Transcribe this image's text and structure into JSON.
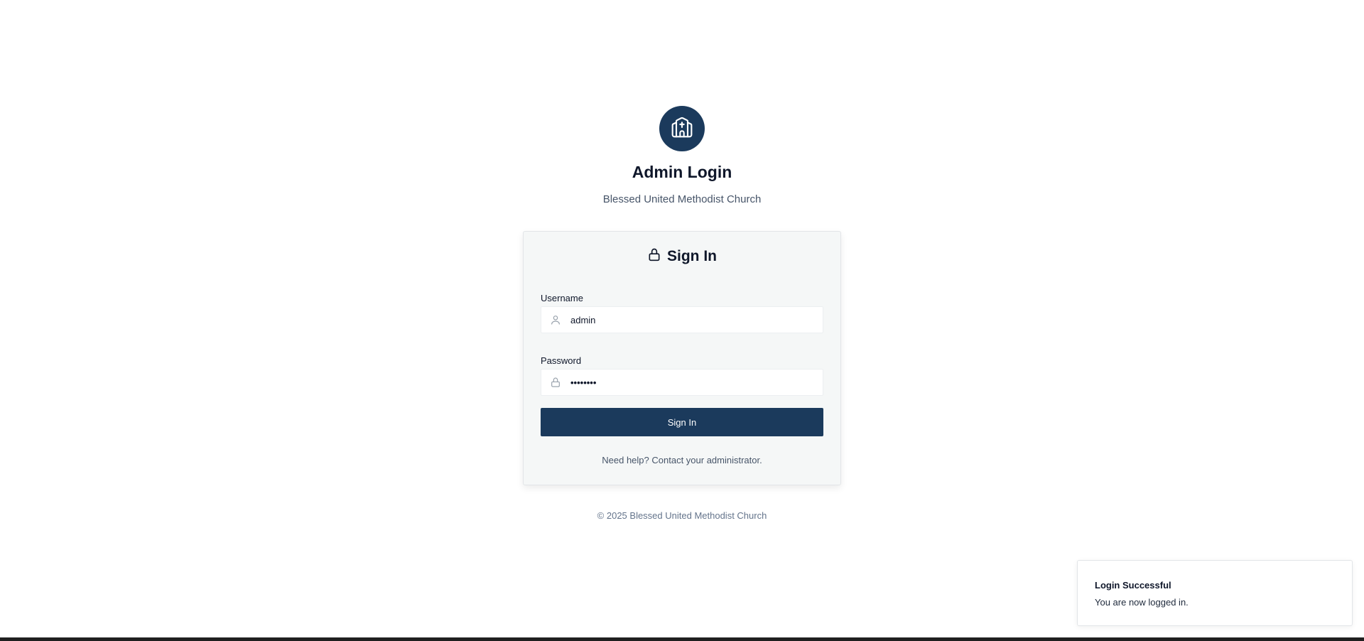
{
  "header": {
    "logo_icon": "church-icon",
    "title": "Admin Login",
    "subtitle": "Blessed United Methodist Church"
  },
  "login_card": {
    "heading": "Sign In",
    "heading_icon": "lock-icon",
    "username": {
      "label": "Username",
      "icon": "user-icon",
      "value": "admin"
    },
    "password": {
      "label": "Password",
      "icon": "lock-icon",
      "masked_value": "••••••••"
    },
    "submit_label": "Sign In",
    "help_text": "Need help? Contact your administrator."
  },
  "footer": {
    "copyright": "© 2025 Blessed United Methodist Church"
  },
  "toast": {
    "title": "Login Successful",
    "description": "You are now logged in."
  },
  "colors": {
    "primary": "#1b3a5c",
    "card_background": "#f5f7f7",
    "text": "#0f172a",
    "muted_text": "#475569"
  }
}
